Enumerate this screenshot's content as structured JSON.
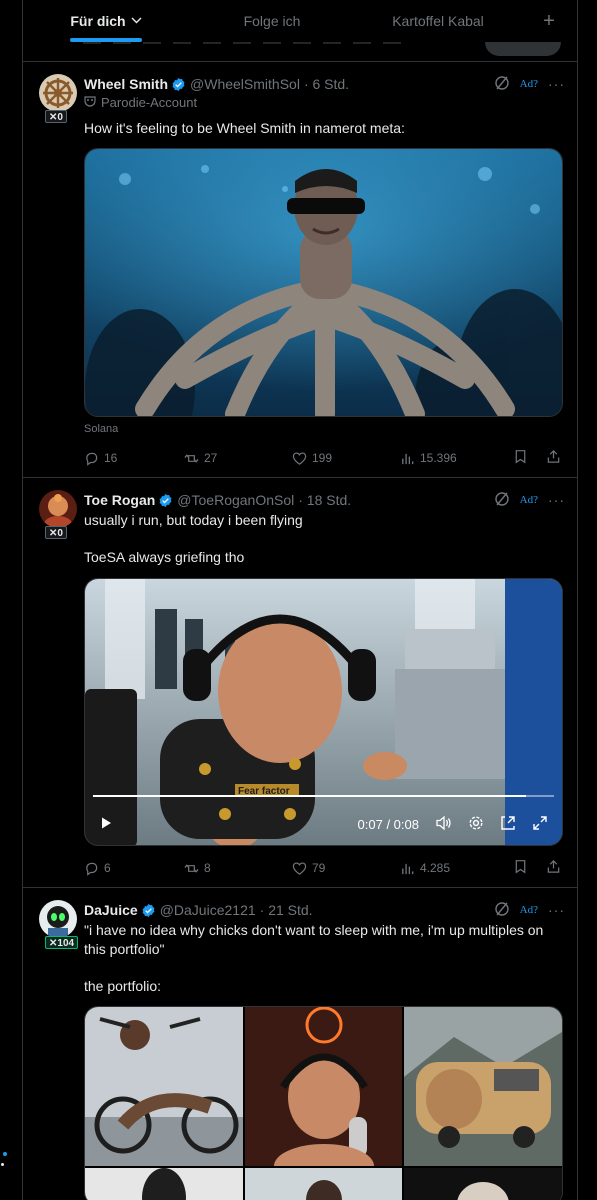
{
  "tabs": {
    "items": [
      {
        "label": "Für dich"
      },
      {
        "label": "Folge ich"
      },
      {
        "label": "Kartoffel Kabal"
      }
    ],
    "plus": "+"
  },
  "tweets": [
    {
      "name": "Wheel Smith",
      "handle": "@WheelSmithSol",
      "time": "· 6 Std.",
      "badge": "✕0",
      "parody": "Parodie-Account",
      "text": "How it's feeling to be Wheel Smith in namerot meta:",
      "ad": "Ad?",
      "more": "···",
      "source": "Solana",
      "replies": "16",
      "reposts": "27",
      "likes": "199",
      "views": "15.396"
    },
    {
      "name": "Toe Rogan",
      "handle": "@ToeRoganOnSol",
      "time": "· 18 Std.",
      "badge": "✕0",
      "text1": "usually i run, but today i been flying",
      "text2": "ToeSA always griefing tho",
      "ad": "Ad?",
      "more": "···",
      "video_time": "0:07 / 0:08",
      "shirt_text": "Fear factor",
      "replies": "6",
      "reposts": "8",
      "likes": "79",
      "views": "4.285"
    },
    {
      "name": "DaJuice",
      "handle": "@DaJuice2121",
      "time": "· 21 Std.",
      "badge": "✕104",
      "text1": "\"i have no idea why chicks don't want to sleep with me, i'm up multiples on this portfolio\"",
      "text2": "the portfolio:",
      "ad": "Ad?",
      "more": "···"
    }
  ],
  "colors": {
    "accent": "#1d9bf0",
    "muted": "#71767b",
    "border": "#2f3336",
    "text": "#e7e9ea",
    "background": "#000000"
  }
}
